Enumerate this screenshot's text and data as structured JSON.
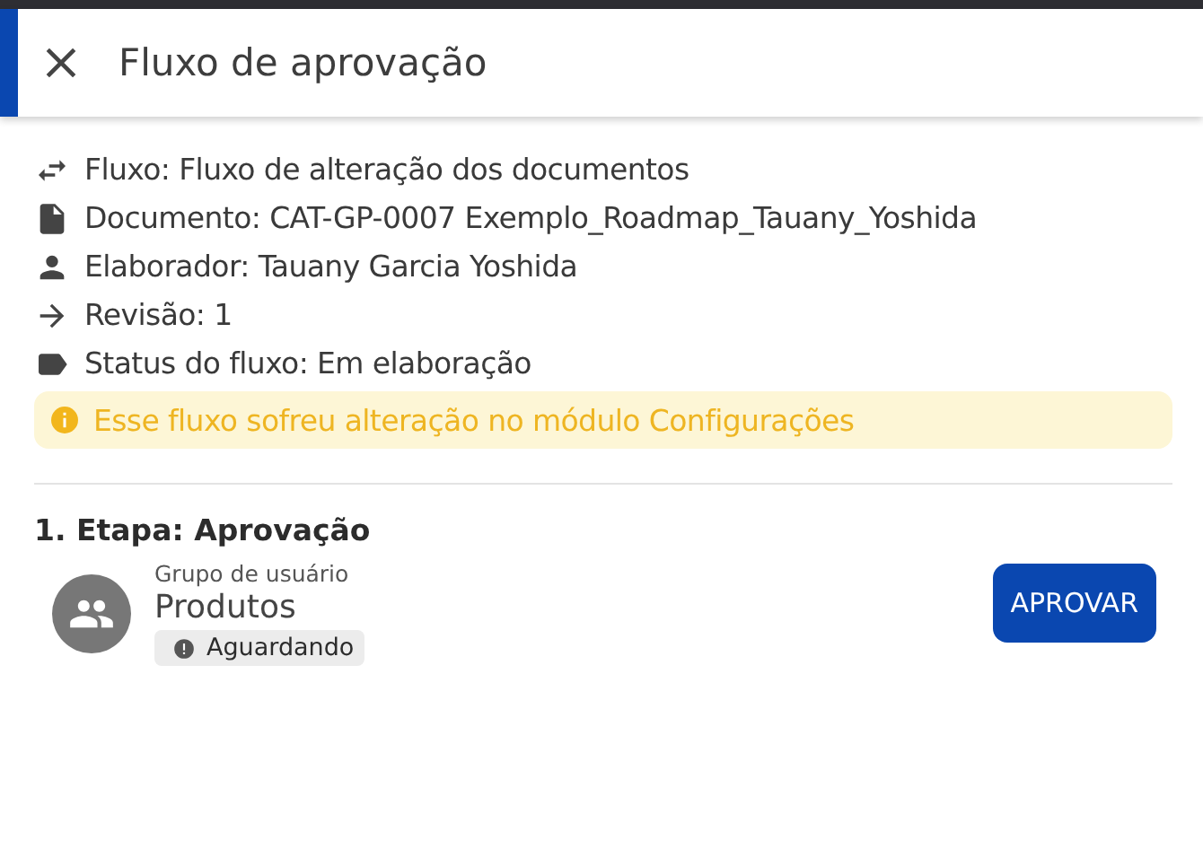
{
  "header": {
    "title": "Fluxo de aprovação"
  },
  "details": [
    {
      "kind": "flow",
      "text": "Fluxo: Fluxo de alteração dos documentos"
    },
    {
      "kind": "document",
      "text": "Documento: CAT-GP-0007 Exemplo_Roadmap_Tauany_Yoshida"
    },
    {
      "kind": "person",
      "text": "Elaborador: Tauany Garcia Yoshida"
    },
    {
      "kind": "revision",
      "text": "Revisão: 1"
    },
    {
      "kind": "status",
      "text": "Status do fluxo: Em elaboração"
    }
  ],
  "warning": "Esse fluxo sofreu alteração no módulo Configurações",
  "stages": [
    {
      "title": "1. Etapa: Aprovação",
      "approvers": [
        {
          "type_label": "Grupo de usuário",
          "name": "Produtos",
          "status": "Aguardando",
          "action": "APROVAR"
        }
      ]
    }
  ]
}
